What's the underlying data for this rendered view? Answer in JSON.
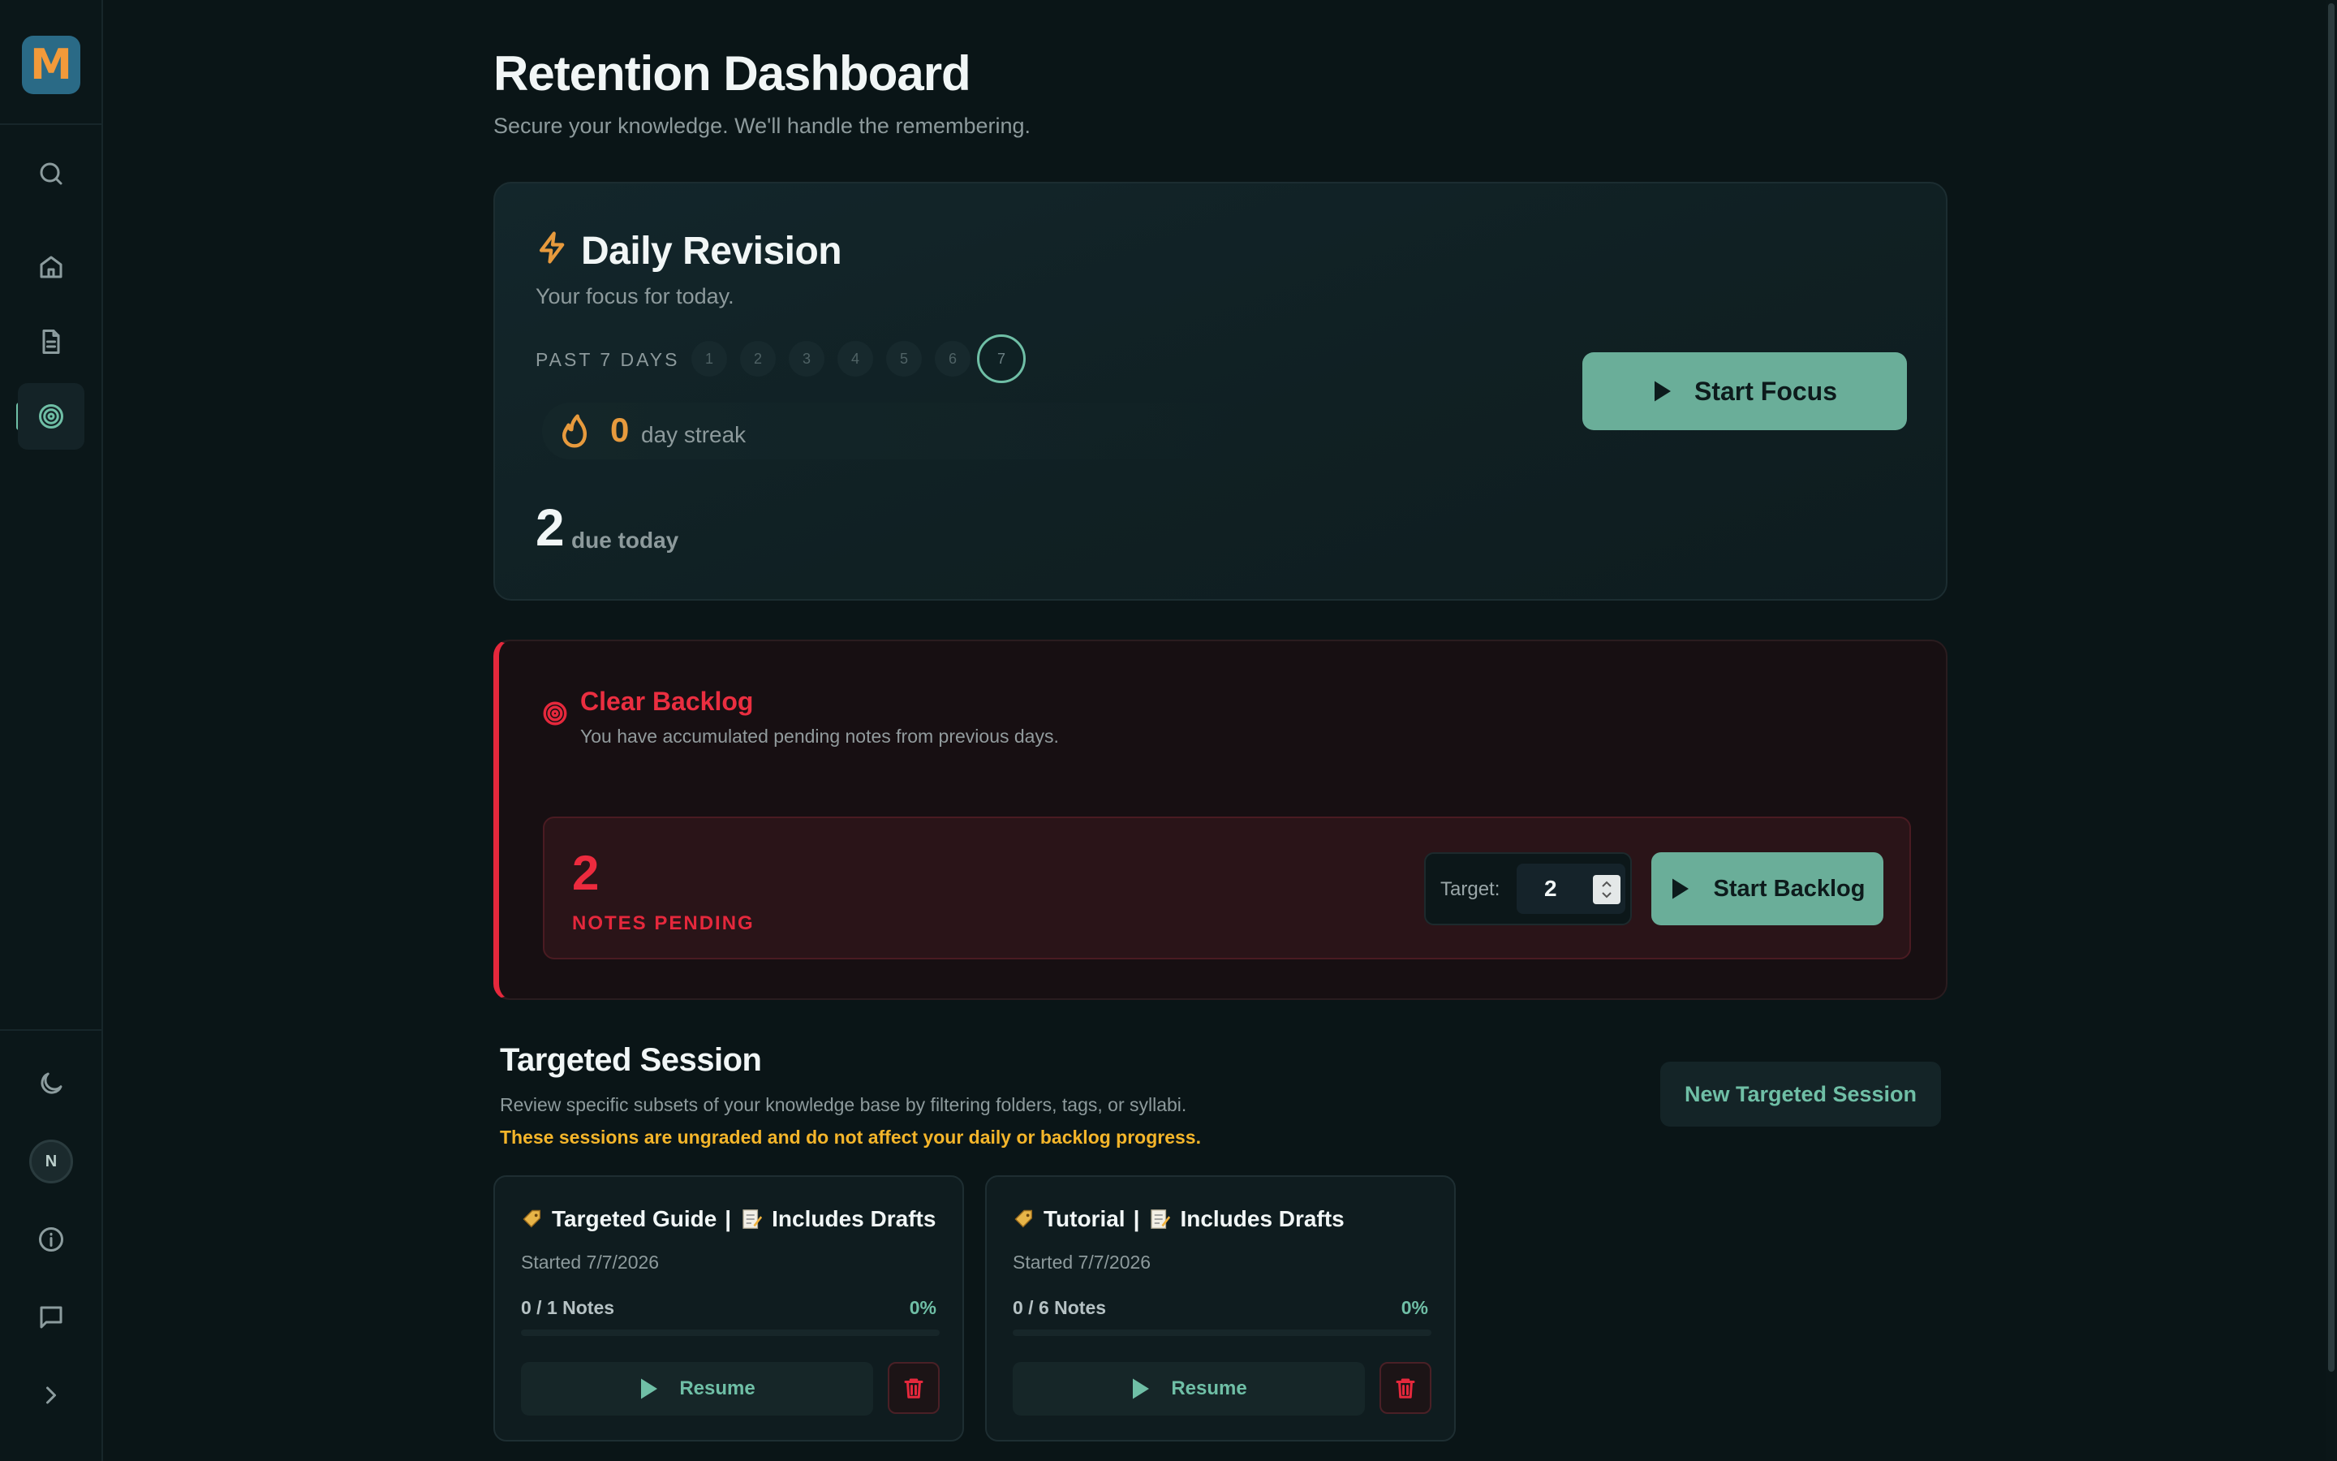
{
  "app": {
    "logo_letter": "M",
    "brand_color": "#2a6a86",
    "accent_color": "#6aae99",
    "danger_color": "#e5283c",
    "warning_color": "#f4b52a"
  },
  "sidebar": {
    "top_icons": [
      "search-icon",
      "home-icon",
      "document-icon",
      "target-icon"
    ],
    "active_item": "target-icon",
    "bottom_icons": [
      "moon-icon",
      "avatar",
      "info-icon",
      "chat-icon",
      "chevron-right-icon"
    ],
    "avatar_initial": "N"
  },
  "header": {
    "title": "Retention Dashboard",
    "subtitle": "Secure your knowledge. We'll handle the remembering."
  },
  "daily_revision": {
    "title": "Daily Revision",
    "subtitle": "Your focus for today.",
    "past_label": "PAST 7 DAYS",
    "days": [
      "1",
      "2",
      "3",
      "4",
      "5",
      "6",
      "7"
    ],
    "today_index": 7,
    "streak_count": "0",
    "streak_label": "day streak",
    "due_count": "2",
    "due_label": "due today",
    "start_button": "Start Focus"
  },
  "backlog": {
    "title": "Clear Backlog",
    "subtitle": "You have accumulated pending notes from previous days.",
    "pending_count": "2",
    "pending_label": "NOTES PENDING",
    "target_label": "Target:",
    "target_value": "2",
    "start_button": "Start Backlog"
  },
  "targeted": {
    "title": "Targeted Session",
    "subtitle": "Review specific subsets of your knowledge base by filtering folders, tags, or syllabi.",
    "warning": "These sessions are ungraded and do not affect your daily or backlog progress.",
    "new_button": "New Targeted Session",
    "sessions": [
      {
        "name": "Targeted Guide",
        "drafts": "Includes Drafts",
        "started": "Started 7/7/2026",
        "notes": "0 / 1 Notes",
        "percent": "0%",
        "progress": 0,
        "resume": "Resume"
      },
      {
        "name": "Tutorial",
        "drafts": "Includes Drafts",
        "started": "Started 7/7/2026",
        "notes": "0 / 6 Notes",
        "percent": "0%",
        "progress": 0,
        "resume": "Resume"
      }
    ]
  }
}
